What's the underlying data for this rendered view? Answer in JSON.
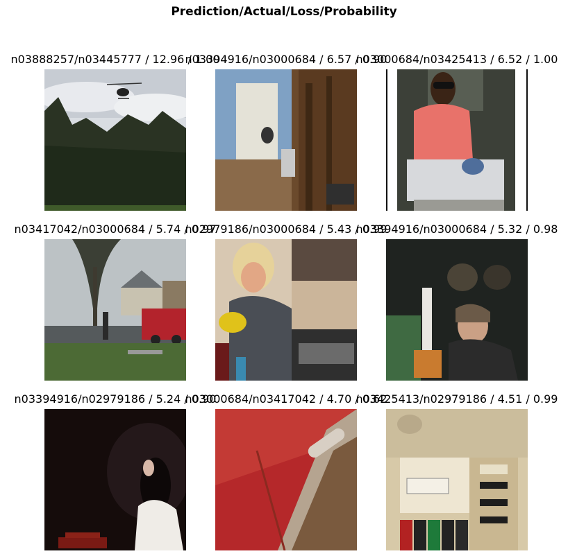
{
  "figure": {
    "title": "Prediction/Actual/Loss/Probability",
    "panels": [
      {
        "label": "n03888257/n03445777 / 12.96 / 1.00",
        "image": "helicopter-over-trees"
      },
      {
        "label": "n03394916/n03000684 / 6.57 / 0.90",
        "image": "man-in-workshop"
      },
      {
        "label": "n03000684/n03425413 / 6.52 / 1.00",
        "image": "woman-with-sunglasses-holding-tool"
      },
      {
        "label": "n03417042/n03000684 / 5.74 / 0.97",
        "image": "street-with-tree-and-truck"
      },
      {
        "label": "n02979186/n03000684 / 5.43 / 0.99",
        "image": "person-in-costume-kitchen"
      },
      {
        "label": "n03394916/n03000684 / 5.32 / 0.98",
        "image": "man-with-chainsaw-and-drums"
      },
      {
        "label": "n03394916/n02979186 / 5.24 / 0.90",
        "image": "woman-sitting-dark-background"
      },
      {
        "label": "n03000684/n03417042 / 4.70 / 0.62",
        "image": "rusty-machine-red-wall"
      },
      {
        "label": "n03425413/n02979186 / 4.51 / 0.99",
        "image": "cassette-recorder"
      }
    ]
  }
}
